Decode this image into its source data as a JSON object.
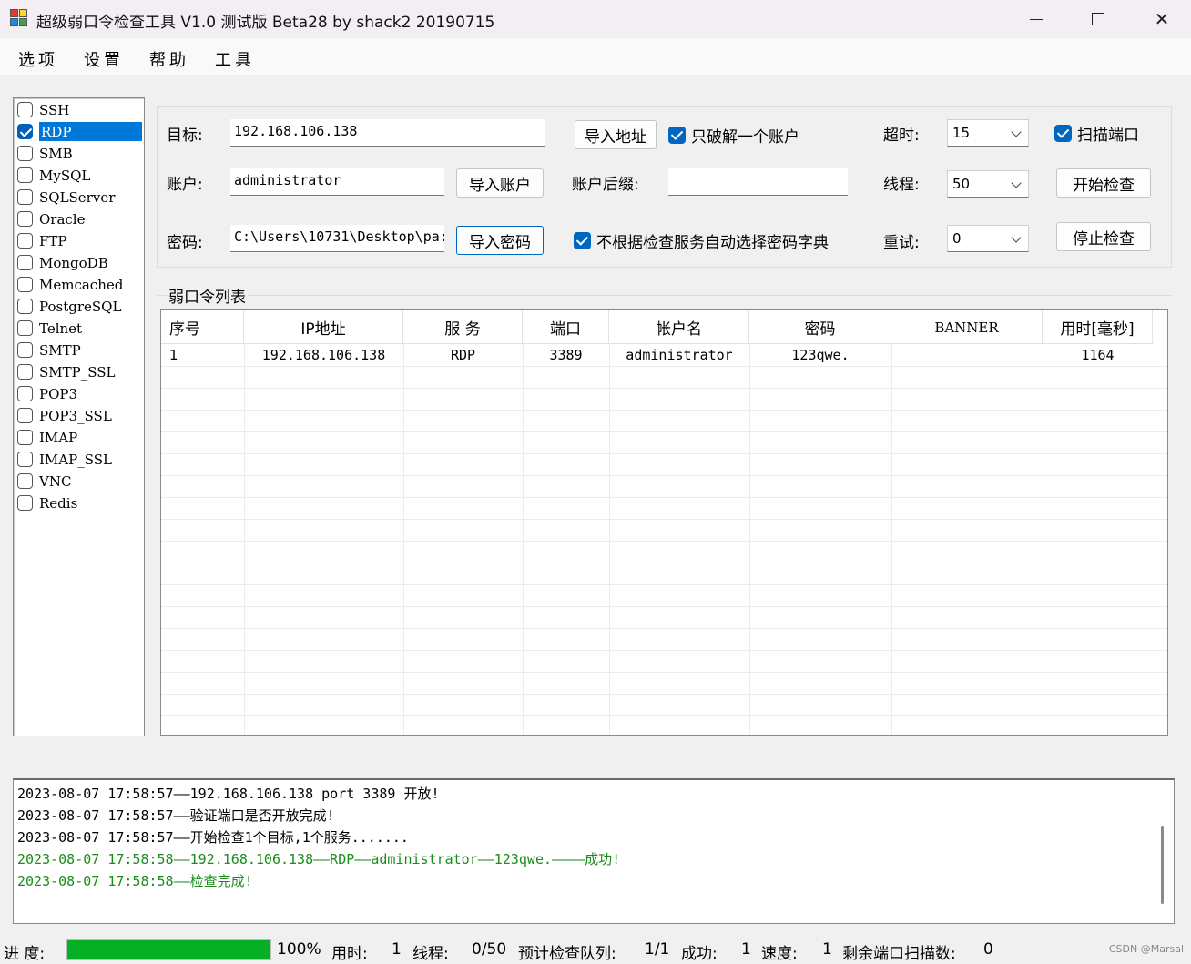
{
  "window": {
    "title": "超级弱口令检查工具 V1.0 测试版 Beta28 by shack2 20190715",
    "min_symbol": "—",
    "max_symbol": "☐",
    "close_symbol": "✕"
  },
  "menu": [
    "选项",
    "设置",
    "帮助",
    "工具"
  ],
  "services": [
    {
      "label": "SSH",
      "checked": false
    },
    {
      "label": "RDP",
      "checked": true
    },
    {
      "label": "SMB",
      "checked": false
    },
    {
      "label": "MySQL",
      "checked": false
    },
    {
      "label": "SQLServer",
      "checked": false
    },
    {
      "label": "Oracle",
      "checked": false
    },
    {
      "label": "FTP",
      "checked": false
    },
    {
      "label": "MongoDB",
      "checked": false
    },
    {
      "label": "Memcached",
      "checked": false
    },
    {
      "label": "PostgreSQL",
      "checked": false
    },
    {
      "label": "Telnet",
      "checked": false
    },
    {
      "label": "SMTP",
      "checked": false
    },
    {
      "label": "SMTP_SSL",
      "checked": false
    },
    {
      "label": "POP3",
      "checked": false
    },
    {
      "label": "POP3_SSL",
      "checked": false
    },
    {
      "label": "IMAP",
      "checked": false
    },
    {
      "label": "IMAP_SSL",
      "checked": false
    },
    {
      "label": "VNC",
      "checked": false
    },
    {
      "label": "Redis",
      "checked": false
    }
  ],
  "form": {
    "target_label": "目标:",
    "target_value": "192.168.106.138",
    "import_address": "导入地址",
    "only_one_account": "只破解一个账户",
    "timeout_label": "超时:",
    "timeout_value": "15",
    "scan_port": "扫描端口",
    "account_label": "账户:",
    "account_value": "administrator",
    "import_account": "导入账户",
    "suffix_label": "账户后缀:",
    "suffix_value": "",
    "threads_label": "线程:",
    "threads_value": "50",
    "start_check": "开始检查",
    "password_label": "密码:",
    "password_value": "C:\\Users\\10731\\Desktop\\pa:",
    "import_password": "导入密码",
    "no_auto_dict": "不根据检查服务自动选择密码字典",
    "retry_label": "重试:",
    "retry_value": "0",
    "stop_check": "停止检查"
  },
  "table": {
    "group_title": "弱口令列表",
    "headers": [
      "序号",
      "IP地址",
      "服 务",
      "端口",
      "帐户名",
      "密码",
      "BANNER",
      "用时[毫秒]"
    ],
    "rows": [
      [
        "1",
        "192.168.106.138",
        "RDP",
        "3389",
        "administrator",
        "123qwe.",
        "",
        "1164"
      ]
    ]
  },
  "log": [
    {
      "text": "2023-08-07 17:58:57——192.168.106.138 port 3389 开放!",
      "color": "#000000"
    },
    {
      "text": "2023-08-07 17:58:57——验证端口是否开放完成!",
      "color": "#000000"
    },
    {
      "text": "2023-08-07 17:58:57——开始检查1个目标,1个服务.......",
      "color": "#000000"
    },
    {
      "text": "2023-08-07 17:58:58——192.168.106.138——RDP——administrator——123qwe.————成功!",
      "color": "#1a8c1a"
    },
    {
      "text": "2023-08-07 17:58:58——检查完成!",
      "color": "#1a8c1a"
    }
  ],
  "status": {
    "progress_label": "进 度:",
    "progress_percent": 100,
    "progress_text": "100%",
    "elapsed_label": "用时:",
    "elapsed_value": "1",
    "threads_label": "线程:",
    "threads_value": "0/50",
    "queue_label": "预计检查队列:",
    "queue_value": "1/1",
    "success_label": "成功:",
    "success_value": "1",
    "speed_label": "速度:",
    "speed_value": "1",
    "remaining_label": "剩余端口扫描数:",
    "remaining_value": "0"
  },
  "watermark": "CSDN @Marsal",
  "colors": {
    "selection": "#0078d7",
    "checkbox": "#0067c0",
    "progress": "#06b025",
    "log_success": "#1a8c1a"
  }
}
